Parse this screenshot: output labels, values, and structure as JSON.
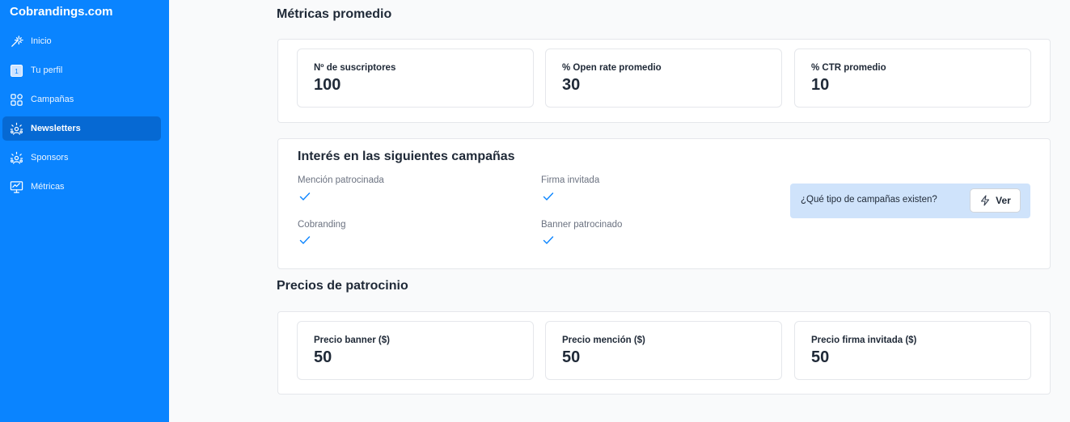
{
  "sidebar": {
    "brand": "Cobrandings.com",
    "items": [
      {
        "label": "Inicio",
        "icon": "magic-wand-icon"
      },
      {
        "label": "Tu perfil",
        "icon": "profile-card-icon"
      },
      {
        "label": "Campañas",
        "icon": "grid-icon"
      },
      {
        "label": "Newsletters",
        "icon": "newsletter-icon",
        "active": true
      },
      {
        "label": "Sponsors",
        "icon": "sponsors-icon"
      },
      {
        "label": "Métricas",
        "icon": "metrics-icon"
      }
    ]
  },
  "metrics": {
    "title": "Métricas promedio",
    "cards": [
      {
        "label": "Nº de suscriptores",
        "value": "100"
      },
      {
        "label": "% Open rate promedio",
        "value": "30"
      },
      {
        "label": "% CTR promedio",
        "value": "10"
      }
    ]
  },
  "interest": {
    "title": "Interés en las siguientes campañas",
    "options": [
      {
        "label": "Mención patrocinada",
        "checked": true
      },
      {
        "label": "Firma invitada",
        "checked": true
      },
      {
        "label": "Cobranding",
        "checked": true
      },
      {
        "label": "Banner patrocinado",
        "checked": true
      }
    ],
    "callout_text": "¿Qué tipo de campañas existen?",
    "callout_button": "Ver"
  },
  "prices": {
    "title": "Precios de patrocinio",
    "cards": [
      {
        "label": "Precio banner ($)",
        "value": "50"
      },
      {
        "label": "Precio mención ($)",
        "value": "50"
      },
      {
        "label": "Precio firma invitada ($)",
        "value": "50"
      }
    ]
  },
  "colors": {
    "sidebar_bg": "#0a84ff",
    "sidebar_active": "#0669d3",
    "check": "#0a84ff",
    "callout_bg": "#cfe3fb"
  }
}
